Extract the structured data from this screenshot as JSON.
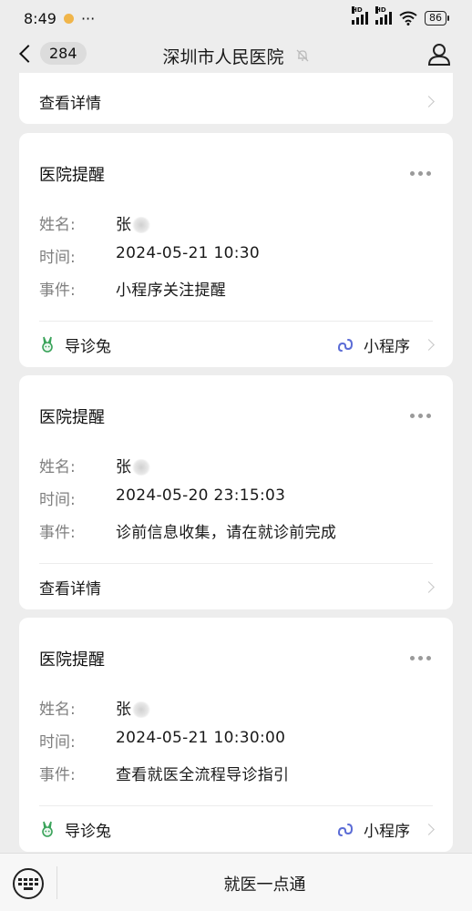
{
  "status_bar": {
    "time": "8:49",
    "dots": "···",
    "battery": "86",
    "hd": "HD"
  },
  "nav": {
    "back_count": "284",
    "title": "深圳市人民医院"
  },
  "top_card": {
    "detail_label": "查看详情"
  },
  "cards": [
    {
      "title": "医院提醒",
      "rows": [
        {
          "label": "姓名:",
          "value": "张"
        },
        {
          "label": "时间:",
          "value": "2024-05-21 10:30"
        },
        {
          "label": "事件:",
          "value": "小程序关注提醒"
        }
      ],
      "footer": {
        "left_label": "导诊兔",
        "right_label": "小程序"
      }
    },
    {
      "title": "医院提醒",
      "rows": [
        {
          "label": "姓名:",
          "value": "张"
        },
        {
          "label": "时间:",
          "value": "2024-05-20 23:15:03"
        },
        {
          "label": "事件:",
          "value": "诊前信息收集，请在就诊前完成"
        }
      ],
      "footer": {
        "left_label": "查看详情"
      }
    },
    {
      "title": "医院提醒",
      "rows": [
        {
          "label": "姓名:",
          "value": "张"
        },
        {
          "label": "时间:",
          "value": "2024-05-21 10:30:00"
        },
        {
          "label": "事件:",
          "value": "查看就医全流程导诊指引"
        }
      ],
      "footer": {
        "left_label": "导诊兔",
        "right_label": "小程序"
      }
    }
  ],
  "bottom_bar": {
    "menu_label": "就医一点通"
  },
  "colors": {
    "background": "#ededed",
    "card": "#ffffff",
    "miniprogram_icon": "#5b6cd6",
    "rabbit_icon": "#3aa35a"
  }
}
